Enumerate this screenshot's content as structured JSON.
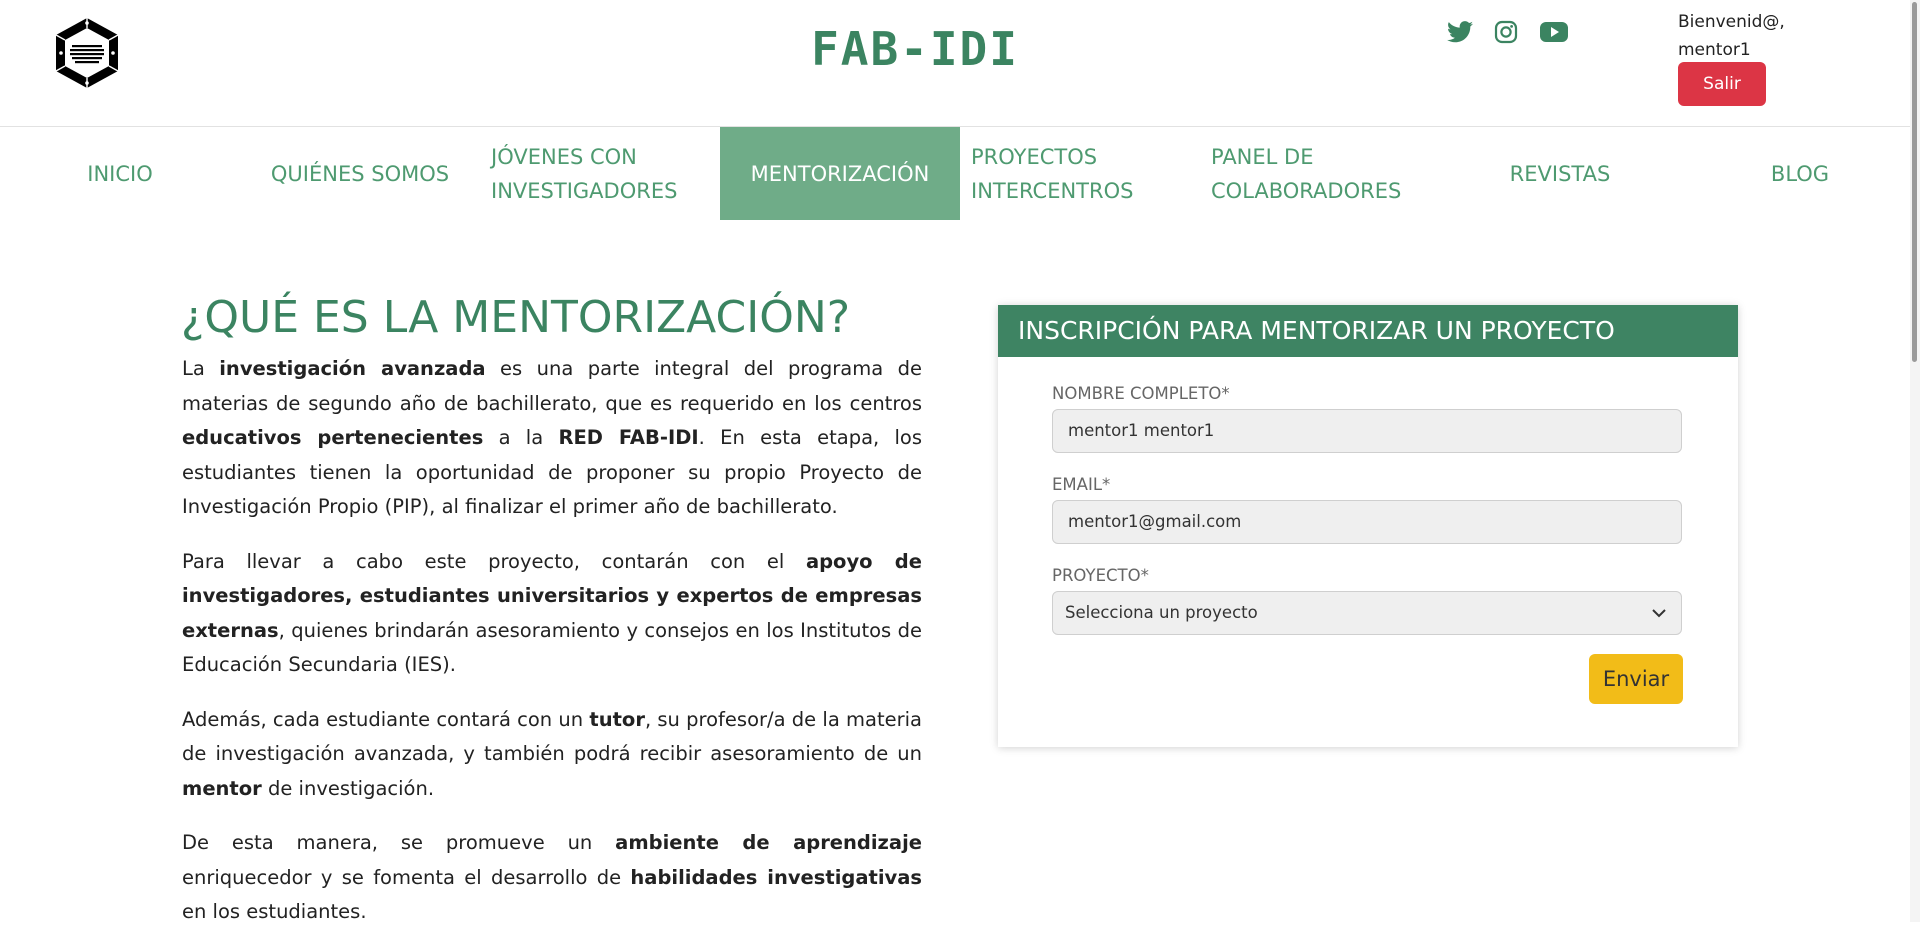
{
  "header": {
    "site_title": "FAB-IDI",
    "social": [
      {
        "icon": "twitter-icon",
        "color": "#3b8461"
      },
      {
        "icon": "instagram-icon",
        "color": "#3b8461"
      },
      {
        "icon": "youtube-icon",
        "color": "#3b8461"
      }
    ],
    "greeting_line1": "Bienvenid@,",
    "greeting_line2": "mentor1",
    "logout_label": "Salir"
  },
  "nav": {
    "items": [
      {
        "label": "INICIO"
      },
      {
        "label": "QUIÉNES SOMOS"
      },
      {
        "label": "JÓVENES CON INVESTIGADORES"
      },
      {
        "label": "MENTORIZACIÓN",
        "active": true
      },
      {
        "label": "PROYECTOS INTERCENTROS"
      },
      {
        "label": "PANEL DE COLABORADORES"
      },
      {
        "label": "REVISTAS"
      },
      {
        "label": "BLOG"
      }
    ]
  },
  "main": {
    "heading": "¿QUÉ ES LA MENTORIZACIÓN?",
    "paragraphs": [
      [
        {
          "t": "La "
        },
        {
          "t": "investigación avanzada",
          "b": true
        },
        {
          "t": " es una parte integral del programa de materias de segundo año de bachillerato, que es requerido en los centros "
        },
        {
          "t": "educativos pertenecientes",
          "b": true
        },
        {
          "t": " a la "
        },
        {
          "t": "RED FAB-IDI",
          "b": true
        },
        {
          "t": ". En esta etapa, los estudiantes tienen la oportunidad de proponer su propio Proyecto de Investigación Propio (PIP), al finalizar el primer año de bachillerato."
        }
      ],
      [
        {
          "t": "Para llevar a cabo este proyecto, contarán con el "
        },
        {
          "t": "apoyo de investigadores, estudiantes universitarios y expertos de empresas externas",
          "b": true
        },
        {
          "t": ", quienes brindarán asesoramiento y consejos en los Institutos de Educación Secundaria (IES)."
        }
      ],
      [
        {
          "t": "Además, cada estudiante contará con un "
        },
        {
          "t": "tutor",
          "b": true
        },
        {
          "t": ", su profesor/a de la materia de investigación avanzada, y también podrá recibir asesoramiento de un "
        },
        {
          "t": "mentor",
          "b": true
        },
        {
          "t": " de investigación."
        }
      ],
      [
        {
          "t": "De esta manera, se promueve un "
        },
        {
          "t": "ambiente de aprendizaje",
          "b": true
        },
        {
          "t": " enriquecedor y se fomenta el desarrollo de "
        },
        {
          "t": "habilidades investigativas",
          "b": true
        },
        {
          "t": " en los estudiantes."
        }
      ]
    ]
  },
  "form": {
    "title": "INSCRIPCIÓN PARA MENTORIZAR UN PROYECTO",
    "name_label": "NOMBRE COMPLETO*",
    "name_value": "mentor1 mentor1",
    "email_label": "EMAIL*",
    "email_value": "mentor1@gmail.com",
    "project_label": "PROYECTO*",
    "project_selected": "Selecciona un proyecto",
    "submit_label": "Enviar"
  },
  "colors": {
    "brand_green": "#3b8461",
    "nav_green": "#4e9a70",
    "nav_active_bg": "#6fac88",
    "logout_red": "#dc3545",
    "submit_yellow": "#f2bc18"
  }
}
